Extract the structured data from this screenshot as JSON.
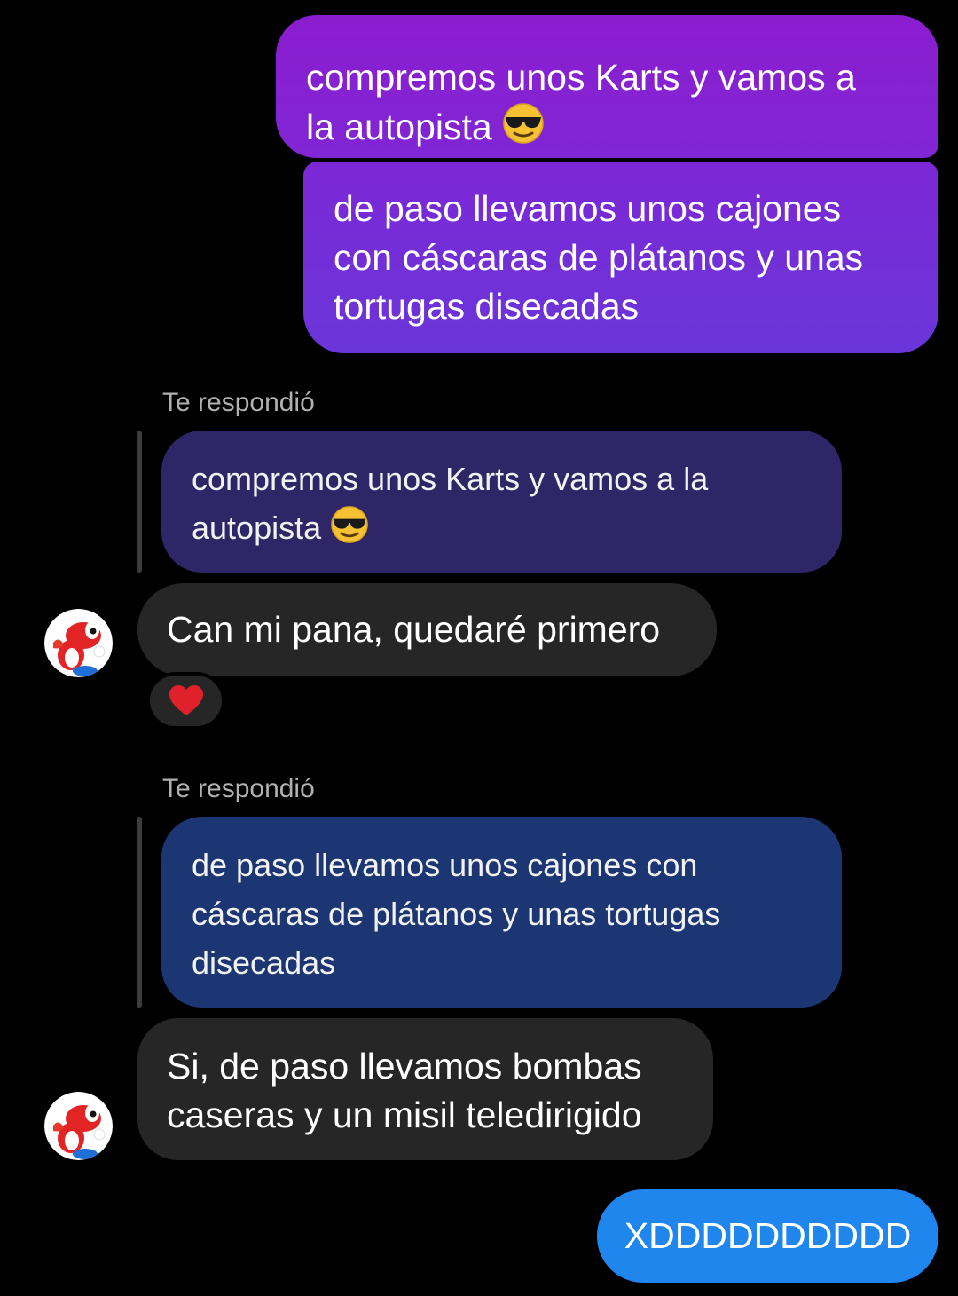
{
  "colors": {
    "background": "#000000",
    "sent_bubble_top": "#8a1fd0",
    "sent_bubble_mid": "#7a28d6",
    "sent_bubble_bottom": "#6a37d8",
    "quote_purple": "#2f2666",
    "quote_blue": "#1b3672",
    "received_bubble": "#262626",
    "last_sent_bubble": "#1f86ee",
    "reply_label": "#b0b0b0",
    "heart": "#e0202a"
  },
  "messages": {
    "sent_1": {
      "line1": "compremos unos Karts y vamos a",
      "line2": "la autopista",
      "emoji_icon": "sunglasses-face-emoji"
    },
    "sent_2": {
      "line1": "de paso llevamos unos cajones",
      "line2": "con cáscaras de plátanos y unas",
      "line3": "tortugas disecadas"
    },
    "reply_1": {
      "label": "Te respondió",
      "quote_line1": "compremos unos Karts y vamos a la",
      "quote_line2": "autopista",
      "quote_emoji_icon": "sunglasses-face-emoji",
      "text": "Can mi pana, quedaré primero",
      "reaction_icon": "red-heart-emoji",
      "avatar_icon": "red-yoshi-avatar"
    },
    "reply_2": {
      "label": "Te respondió",
      "quote_line1": "de paso llevamos unos cajones con",
      "quote_line2": "cáscaras de plátanos y unas tortugas",
      "quote_line3": "disecadas",
      "text_line1": "Si, de paso llevamos bombas",
      "text_line2": "caseras y un misil teledirigido",
      "avatar_icon": "red-yoshi-avatar"
    },
    "sent_3": {
      "text": "XDDDDDDDDDD"
    }
  }
}
